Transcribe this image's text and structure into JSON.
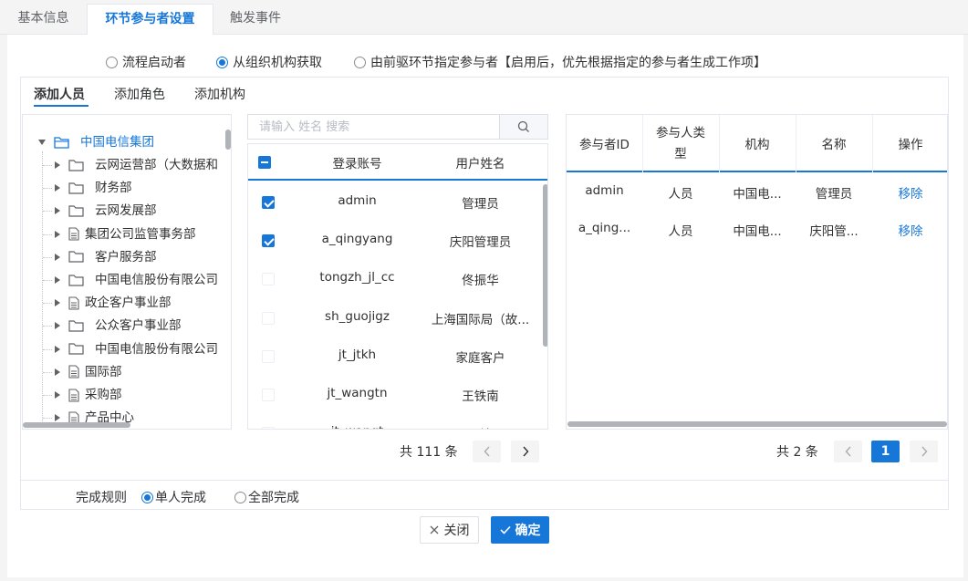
{
  "tabs": [
    {
      "label": "基本信息",
      "active": false
    },
    {
      "label": "环节参与者设置",
      "active": true
    },
    {
      "label": "触发事件",
      "active": false
    }
  ],
  "participant_source": {
    "options": [
      {
        "label": "流程启动者",
        "selected": false
      },
      {
        "label": "从组织机构获取",
        "selected": true
      },
      {
        "label": "由前驱环节指定参与者【启用后，优先根据指定的参与者生成工作项】",
        "selected": false
      }
    ]
  },
  "subtabs": [
    {
      "label": "添加人员",
      "active": true
    },
    {
      "label": "添加角色",
      "active": false
    },
    {
      "label": "添加机构",
      "active": false
    }
  ],
  "tree": {
    "root": "中国电信集团",
    "children": [
      {
        "label": "云网运营部（大数据和",
        "type": "folder"
      },
      {
        "label": "财务部",
        "type": "folder"
      },
      {
        "label": "云网发展部",
        "type": "folder"
      },
      {
        "label": "集团公司监管事务部",
        "type": "doc"
      },
      {
        "label": "客户服务部",
        "type": "folder"
      },
      {
        "label": "中国电信股份有限公司",
        "type": "folder"
      },
      {
        "label": "政企客户事业部",
        "type": "doc"
      },
      {
        "label": "公众客户事业部",
        "type": "folder"
      },
      {
        "label": "中国电信股份有限公司",
        "type": "folder"
      },
      {
        "label": "国际部",
        "type": "doc"
      },
      {
        "label": "采购部",
        "type": "doc"
      },
      {
        "label": "产品中心",
        "type": "doc"
      }
    ]
  },
  "search": {
    "placeholder": "请输入 姓名 搜索",
    "value": ""
  },
  "user_table": {
    "headers": [
      "登录账号",
      "用户姓名"
    ],
    "rows": [
      {
        "account": "admin",
        "name": "管理员",
        "checked": true
      },
      {
        "account": "a_qingyang",
        "name": "庆阳管理员",
        "checked": true
      },
      {
        "account": "tongzh_jl_cc",
        "name": "佟振华",
        "checked": false
      },
      {
        "account": "sh_guojigz",
        "name": "上海国际局（故...",
        "checked": false
      },
      {
        "account": "jt_jtkh",
        "name": "家庭客户",
        "checked": false
      },
      {
        "account": "jt_wangtn",
        "name": "王铁南",
        "checked": false
      },
      {
        "account": "jt_wangt",
        "name": "王涛",
        "checked": false
      }
    ],
    "pager": {
      "total_text": "共 111 条"
    }
  },
  "selected_table": {
    "headers": [
      "参与者ID",
      "参与人类型",
      "机构",
      "名称",
      "操作"
    ],
    "rows": [
      {
        "id": "admin",
        "type": "人员",
        "org": "中国电...",
        "name": "管理员",
        "action": "移除"
      },
      {
        "id": "a_qing...",
        "type": "人员",
        "org": "中国电...",
        "name": "庆阳管...",
        "action": "移除"
      }
    ],
    "pager": {
      "total_text": "共 2 条",
      "current_page": "1"
    }
  },
  "completion_rule": {
    "label": "完成规则",
    "options": [
      {
        "label": "单人完成",
        "selected": true
      },
      {
        "label": "全部完成",
        "selected": false
      }
    ]
  },
  "buttons": {
    "close": "关闭",
    "ok": "确定"
  },
  "colors": {
    "accent": "#1677d9",
    "border": "#e4e7ed",
    "text": "#303133"
  }
}
